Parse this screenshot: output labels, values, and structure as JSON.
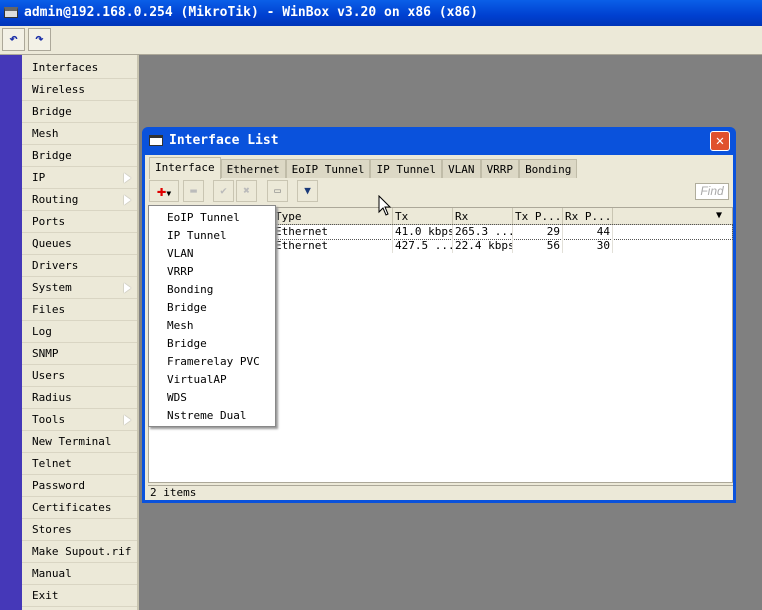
{
  "app": {
    "title": "admin@192.168.0.254 (MikroTik) - WinBox v3.20 on x86 (x86)"
  },
  "toolbar": {
    "undo_icon": "undo-icon",
    "redo_icon": "redo-icon"
  },
  "sidebar": {
    "items": [
      {
        "label": "Interfaces"
      },
      {
        "label": "Wireless"
      },
      {
        "label": "Bridge"
      },
      {
        "label": "Mesh"
      },
      {
        "label": "Bridge"
      },
      {
        "label": "IP",
        "submenu": true
      },
      {
        "label": "Routing",
        "submenu": true
      },
      {
        "label": "Ports"
      },
      {
        "label": "Queues"
      },
      {
        "label": "Drivers"
      },
      {
        "label": "System",
        "submenu": true
      },
      {
        "label": "Files"
      },
      {
        "label": "Log"
      },
      {
        "label": "SNMP"
      },
      {
        "label": "Users"
      },
      {
        "label": "Radius"
      },
      {
        "label": "Tools",
        "submenu": true
      },
      {
        "label": "New Terminal"
      },
      {
        "label": "Telnet"
      },
      {
        "label": "Password"
      },
      {
        "label": "Certificates"
      },
      {
        "label": "Stores"
      },
      {
        "label": "Make Supout.rif"
      },
      {
        "label": "Manual"
      },
      {
        "label": "Exit"
      }
    ]
  },
  "window": {
    "title": "Interface List",
    "tabs": [
      {
        "label": "Interface",
        "active": true
      },
      {
        "label": "Ethernet"
      },
      {
        "label": "EoIP Tunnel"
      },
      {
        "label": "IP Tunnel"
      },
      {
        "label": "VLAN"
      },
      {
        "label": "VRRP"
      },
      {
        "label": "Bonding"
      }
    ],
    "find_placeholder": "Find",
    "columns": [
      "Type",
      "Tx",
      "Rx",
      "Tx P...",
      "Rx P..."
    ],
    "rows": [
      [
        "Ethernet",
        "41.0 kbps",
        "265.3 ...",
        "29",
        "44"
      ],
      [
        "Ethernet",
        "427.5 ...",
        "22.4 kbps",
        "56",
        "30"
      ]
    ],
    "status": "2 items",
    "add_menu": [
      "EoIP Tunnel",
      "IP Tunnel",
      "VLAN",
      "VRRP",
      "Bonding",
      "Bridge",
      "Mesh",
      "Bridge",
      "Framerelay PVC",
      "VirtualAP",
      "WDS",
      "Nstreme Dual"
    ]
  },
  "colors": {
    "titlebar": "#0a52dc",
    "sidebar_strip": "#4538b8",
    "add_icon": "#e00000"
  }
}
